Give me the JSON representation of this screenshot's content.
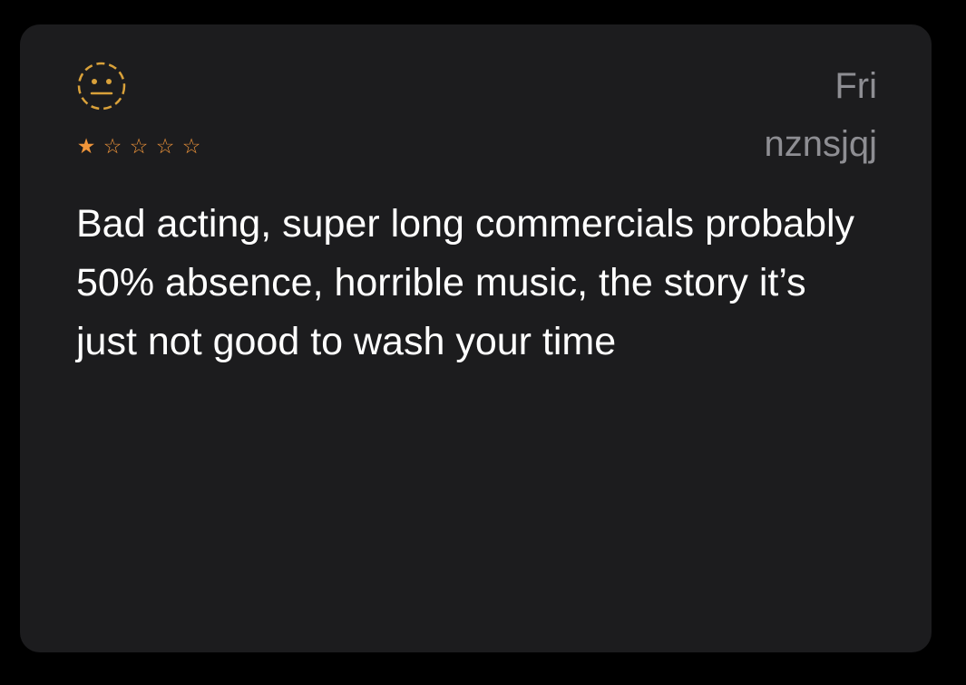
{
  "review": {
    "mood_icon": "neutral-face-icon",
    "rating": 1,
    "rating_max": 5,
    "date": "Fri",
    "author": "nznsjqj",
    "text": "Bad acting, super long commercials probably 50% absence, horrible music, the story it’s just not good to wash your time"
  },
  "colors": {
    "background": "#000000",
    "card": "#1c1c1e",
    "star": "#f0953a",
    "face_icon": "#d9a13a",
    "meta_text": "#8e8e93",
    "body_text": "#ffffff"
  }
}
